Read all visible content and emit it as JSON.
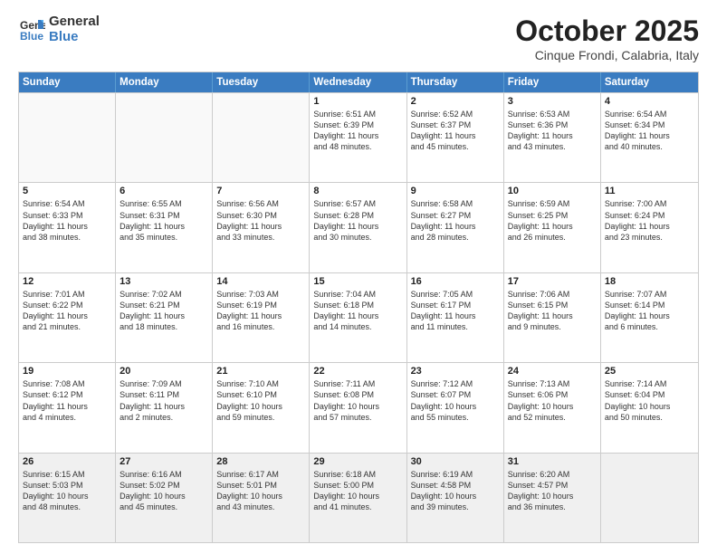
{
  "logo": {
    "general": "General",
    "blue": "Blue"
  },
  "header": {
    "month": "October 2025",
    "location": "Cinque Frondi, Calabria, Italy"
  },
  "weekdays": [
    "Sunday",
    "Monday",
    "Tuesday",
    "Wednesday",
    "Thursday",
    "Friday",
    "Saturday"
  ],
  "weeks": [
    [
      {
        "day": "",
        "text": ""
      },
      {
        "day": "",
        "text": ""
      },
      {
        "day": "",
        "text": ""
      },
      {
        "day": "1",
        "text": "Sunrise: 6:51 AM\nSunset: 6:39 PM\nDaylight: 11 hours\nand 48 minutes."
      },
      {
        "day": "2",
        "text": "Sunrise: 6:52 AM\nSunset: 6:37 PM\nDaylight: 11 hours\nand 45 minutes."
      },
      {
        "day": "3",
        "text": "Sunrise: 6:53 AM\nSunset: 6:36 PM\nDaylight: 11 hours\nand 43 minutes."
      },
      {
        "day": "4",
        "text": "Sunrise: 6:54 AM\nSunset: 6:34 PM\nDaylight: 11 hours\nand 40 minutes."
      }
    ],
    [
      {
        "day": "5",
        "text": "Sunrise: 6:54 AM\nSunset: 6:33 PM\nDaylight: 11 hours\nand 38 minutes."
      },
      {
        "day": "6",
        "text": "Sunrise: 6:55 AM\nSunset: 6:31 PM\nDaylight: 11 hours\nand 35 minutes."
      },
      {
        "day": "7",
        "text": "Sunrise: 6:56 AM\nSunset: 6:30 PM\nDaylight: 11 hours\nand 33 minutes."
      },
      {
        "day": "8",
        "text": "Sunrise: 6:57 AM\nSunset: 6:28 PM\nDaylight: 11 hours\nand 30 minutes."
      },
      {
        "day": "9",
        "text": "Sunrise: 6:58 AM\nSunset: 6:27 PM\nDaylight: 11 hours\nand 28 minutes."
      },
      {
        "day": "10",
        "text": "Sunrise: 6:59 AM\nSunset: 6:25 PM\nDaylight: 11 hours\nand 26 minutes."
      },
      {
        "day": "11",
        "text": "Sunrise: 7:00 AM\nSunset: 6:24 PM\nDaylight: 11 hours\nand 23 minutes."
      }
    ],
    [
      {
        "day": "12",
        "text": "Sunrise: 7:01 AM\nSunset: 6:22 PM\nDaylight: 11 hours\nand 21 minutes."
      },
      {
        "day": "13",
        "text": "Sunrise: 7:02 AM\nSunset: 6:21 PM\nDaylight: 11 hours\nand 18 minutes."
      },
      {
        "day": "14",
        "text": "Sunrise: 7:03 AM\nSunset: 6:19 PM\nDaylight: 11 hours\nand 16 minutes."
      },
      {
        "day": "15",
        "text": "Sunrise: 7:04 AM\nSunset: 6:18 PM\nDaylight: 11 hours\nand 14 minutes."
      },
      {
        "day": "16",
        "text": "Sunrise: 7:05 AM\nSunset: 6:17 PM\nDaylight: 11 hours\nand 11 minutes."
      },
      {
        "day": "17",
        "text": "Sunrise: 7:06 AM\nSunset: 6:15 PM\nDaylight: 11 hours\nand 9 minutes."
      },
      {
        "day": "18",
        "text": "Sunrise: 7:07 AM\nSunset: 6:14 PM\nDaylight: 11 hours\nand 6 minutes."
      }
    ],
    [
      {
        "day": "19",
        "text": "Sunrise: 7:08 AM\nSunset: 6:12 PM\nDaylight: 11 hours\nand 4 minutes."
      },
      {
        "day": "20",
        "text": "Sunrise: 7:09 AM\nSunset: 6:11 PM\nDaylight: 11 hours\nand 2 minutes."
      },
      {
        "day": "21",
        "text": "Sunrise: 7:10 AM\nSunset: 6:10 PM\nDaylight: 10 hours\nand 59 minutes."
      },
      {
        "day": "22",
        "text": "Sunrise: 7:11 AM\nSunset: 6:08 PM\nDaylight: 10 hours\nand 57 minutes."
      },
      {
        "day": "23",
        "text": "Sunrise: 7:12 AM\nSunset: 6:07 PM\nDaylight: 10 hours\nand 55 minutes."
      },
      {
        "day": "24",
        "text": "Sunrise: 7:13 AM\nSunset: 6:06 PM\nDaylight: 10 hours\nand 52 minutes."
      },
      {
        "day": "25",
        "text": "Sunrise: 7:14 AM\nSunset: 6:04 PM\nDaylight: 10 hours\nand 50 minutes."
      }
    ],
    [
      {
        "day": "26",
        "text": "Sunrise: 6:15 AM\nSunset: 5:03 PM\nDaylight: 10 hours\nand 48 minutes."
      },
      {
        "day": "27",
        "text": "Sunrise: 6:16 AM\nSunset: 5:02 PM\nDaylight: 10 hours\nand 45 minutes."
      },
      {
        "day": "28",
        "text": "Sunrise: 6:17 AM\nSunset: 5:01 PM\nDaylight: 10 hours\nand 43 minutes."
      },
      {
        "day": "29",
        "text": "Sunrise: 6:18 AM\nSunset: 5:00 PM\nDaylight: 10 hours\nand 41 minutes."
      },
      {
        "day": "30",
        "text": "Sunrise: 6:19 AM\nSunset: 4:58 PM\nDaylight: 10 hours\nand 39 minutes."
      },
      {
        "day": "31",
        "text": "Sunrise: 6:20 AM\nSunset: 4:57 PM\nDaylight: 10 hours\nand 36 minutes."
      },
      {
        "day": "",
        "text": ""
      }
    ]
  ]
}
